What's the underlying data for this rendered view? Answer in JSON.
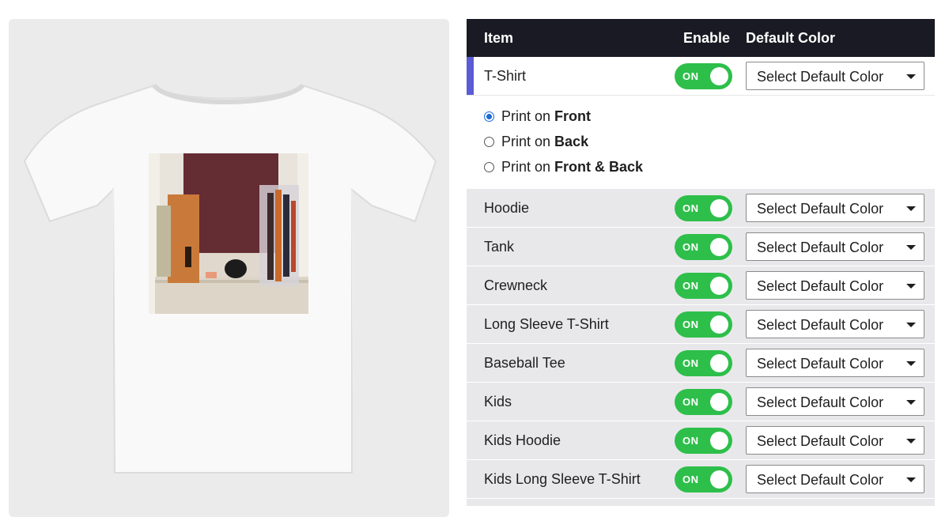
{
  "preview": {
    "image_alt": "T-Shirt preview"
  },
  "table": {
    "headers": {
      "item": "Item",
      "enable": "Enable",
      "color": "Default Color"
    },
    "toggle_on_text": "ON",
    "select_placeholder": "Select Default Color",
    "print_options": [
      {
        "prefix": "Print on",
        "target": "Front",
        "checked": true
      },
      {
        "prefix": "Print on",
        "target": "Back",
        "checked": false
      },
      {
        "prefix": "Print on",
        "target": "Front & Back",
        "checked": false
      }
    ],
    "rows": [
      {
        "label": "T-Shirt",
        "enabled": true
      },
      {
        "label": "Hoodie",
        "enabled": true
      },
      {
        "label": "Tank",
        "enabled": true
      },
      {
        "label": "Crewneck",
        "enabled": true
      },
      {
        "label": "Long Sleeve T-Shirt",
        "enabled": true
      },
      {
        "label": "Baseball Tee",
        "enabled": true
      },
      {
        "label": "Kids",
        "enabled": true
      },
      {
        "label": "Kids Hoodie",
        "enabled": true
      },
      {
        "label": "Kids Long Sleeve T-Shirt",
        "enabled": true
      }
    ]
  },
  "colors": {
    "header_bg": "#1a1a24",
    "toggle_on": "#2dbf4a",
    "active_accent": "#5b5bd6",
    "radio_checked": "#1a6ad8"
  }
}
